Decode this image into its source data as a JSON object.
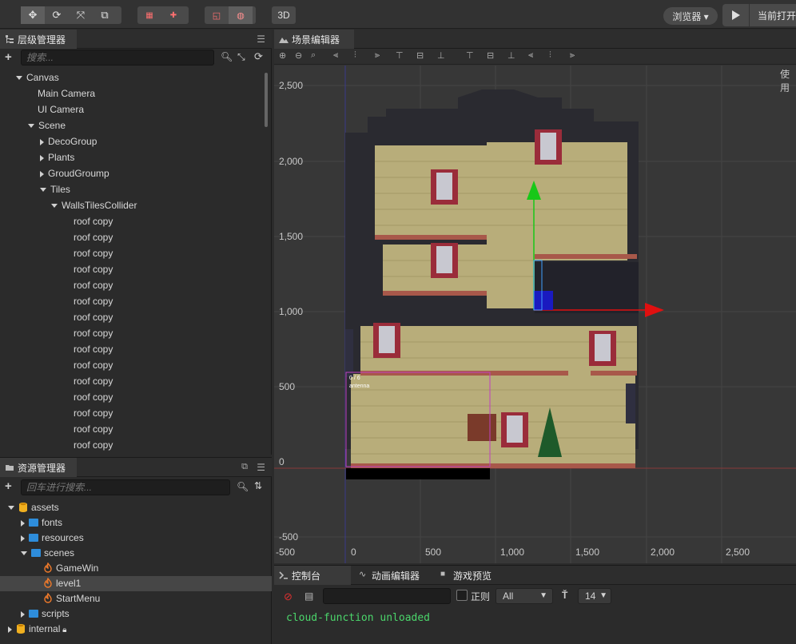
{
  "toolbar": {
    "three_d_label": "3D",
    "browser_label": "浏览器 ▾",
    "open_label": "当前打开"
  },
  "hierarchy": {
    "title": "层级管理器",
    "search_placeholder": "搜索...",
    "rows": [
      {
        "label": "Canvas",
        "indent": 0,
        "arrow": "down"
      },
      {
        "label": "Main Camera",
        "indent": 1,
        "arrow": "none"
      },
      {
        "label": "UI Camera",
        "indent": 1,
        "arrow": "none"
      },
      {
        "label": "Scene",
        "indent": 1,
        "arrow": "down"
      },
      {
        "label": "DecoGroup",
        "indent": 2,
        "arrow": "right"
      },
      {
        "label": "Plants",
        "indent": 2,
        "arrow": "right"
      },
      {
        "label": "GroudGroump",
        "indent": 2,
        "arrow": "right"
      },
      {
        "label": "Tiles",
        "indent": 2,
        "arrow": "down"
      },
      {
        "label": "WallsTilesCollider",
        "indent": 3,
        "arrow": "down"
      },
      {
        "label": "roof copy",
        "indent": 4,
        "arrow": "none"
      },
      {
        "label": "roof copy",
        "indent": 4,
        "arrow": "none"
      },
      {
        "label": "roof copy",
        "indent": 4,
        "arrow": "none"
      },
      {
        "label": "roof copy",
        "indent": 4,
        "arrow": "none"
      },
      {
        "label": "roof copy",
        "indent": 4,
        "arrow": "none"
      },
      {
        "label": "roof copy",
        "indent": 4,
        "arrow": "none"
      },
      {
        "label": "roof copy",
        "indent": 4,
        "arrow": "none"
      },
      {
        "label": "roof copy",
        "indent": 4,
        "arrow": "none"
      },
      {
        "label": "roof copy",
        "indent": 4,
        "arrow": "none"
      },
      {
        "label": "roof copy",
        "indent": 4,
        "arrow": "none"
      },
      {
        "label": "roof copy",
        "indent": 4,
        "arrow": "none"
      },
      {
        "label": "roof copy",
        "indent": 4,
        "arrow": "none"
      },
      {
        "label": "roof copy",
        "indent": 4,
        "arrow": "none"
      },
      {
        "label": "roof copy",
        "indent": 4,
        "arrow": "none"
      },
      {
        "label": "roof copy",
        "indent": 4,
        "arrow": "none"
      }
    ]
  },
  "assets": {
    "title": "资源管理器",
    "search_placeholder": "回车进行搜索...",
    "rows": [
      {
        "label": "assets",
        "indent": 0,
        "arrow": "down",
        "kind": "db"
      },
      {
        "label": "fonts",
        "indent": 1,
        "arrow": "right",
        "kind": "folder"
      },
      {
        "label": "resources",
        "indent": 1,
        "arrow": "right",
        "kind": "folder"
      },
      {
        "label": "scenes",
        "indent": 1,
        "arrow": "down",
        "kind": "folder"
      },
      {
        "label": "GameWin",
        "indent": 2,
        "arrow": "none",
        "kind": "scene"
      },
      {
        "label": "level1",
        "indent": 2,
        "arrow": "none",
        "kind": "scene",
        "selected": true
      },
      {
        "label": "StartMenu",
        "indent": 2,
        "arrow": "none",
        "kind": "scene"
      },
      {
        "label": "scripts",
        "indent": 1,
        "arrow": "right",
        "kind": "folder"
      },
      {
        "label": "internal",
        "indent": 0,
        "arrow": "right",
        "kind": "db-lock"
      }
    ]
  },
  "scene_editor": {
    "title": "场景编辑器",
    "hint": "使用",
    "y_labels": [
      "2,500",
      "2,000",
      "1,500",
      "1,000",
      "500",
      "0",
      "-500"
    ],
    "x_labels": [
      "-500",
      "0",
      "500",
      "1,000",
      "1,500",
      "2,000",
      "2,500"
    ],
    "node_label_1": "0 / 6",
    "node_label_2": "antenna"
  },
  "console": {
    "tabs": [
      "控制台",
      "动画编辑器",
      "游戏预览"
    ],
    "regex_label": "正则",
    "level_value": "All",
    "font_size_value": "14",
    "log_lines": [
      "cloud-function unloaded"
    ]
  },
  "colors": {
    "accent_green": "#4bd66b",
    "gizmo_red": "#e01010",
    "gizmo_green": "#18c818",
    "selection_magenta": "#c040c0"
  }
}
